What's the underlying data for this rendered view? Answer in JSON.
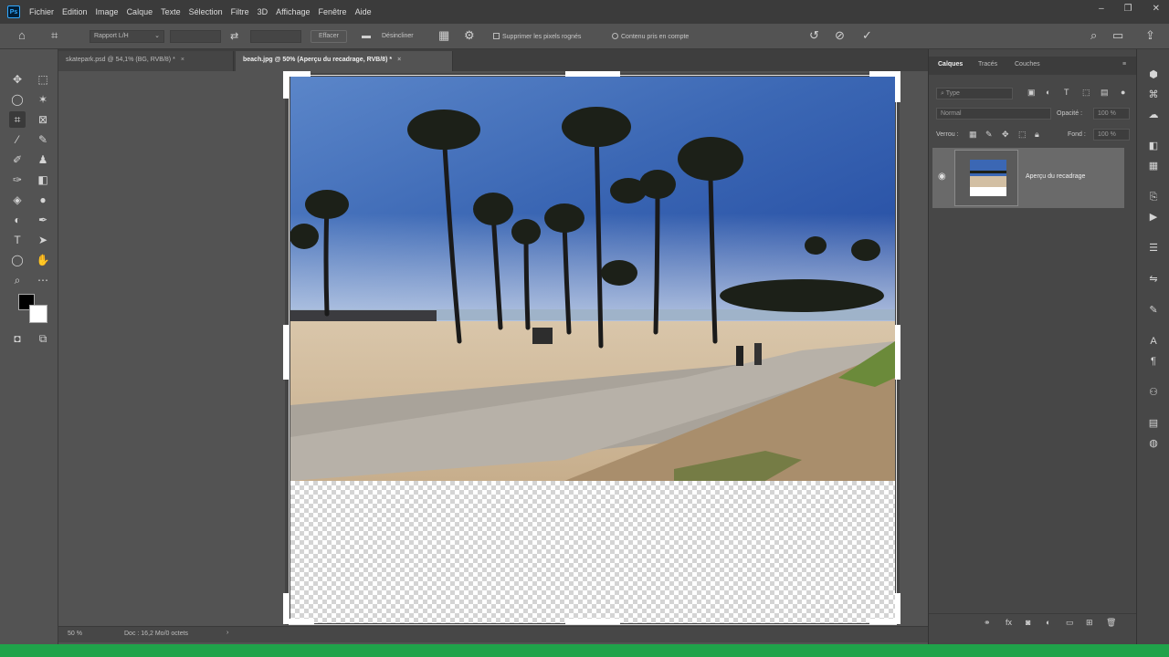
{
  "menubar": {
    "items": [
      "Fichier",
      "Edition",
      "Image",
      "Calque",
      "Texte",
      "Sélection",
      "Filtre",
      "3D",
      "Affichage",
      "Fenêtre",
      "Aide"
    ],
    "logo": "Ps"
  },
  "options": {
    "ratio": "Rapport L/H",
    "clear_label": "Effacer",
    "straighten_label": "Désincliner",
    "delete_pixels_label": "Supprimer les pixels rognés",
    "content_aware_label": "Contenu pris en compte"
  },
  "tabs": [
    {
      "label": "skatepark.psd @ 54,1% (BG, RVB/8) *"
    },
    {
      "label": "beach.jpg @ 50% (Aperçu du recadrage, RVB/8) *"
    }
  ],
  "statusbar": {
    "zoom": "50 %",
    "doc": "Doc : 16,2 Mo/0 octets"
  },
  "layers_panel": {
    "tabs": [
      "Calques",
      "Tracés",
      "Couches"
    ],
    "kind_placeholder": "Type",
    "blend_mode": "Normal",
    "opacity_label": "Opacité :",
    "opacity_value": "100 %",
    "lock_label": "Verrou :",
    "fill_label": "Fond :",
    "fill_value": "100 %",
    "layer_name": "Aperçu du recadrage"
  },
  "colors": {
    "accent": "#31a8ff",
    "taskbar": "#1fa34a",
    "app_bg": "#535353"
  }
}
